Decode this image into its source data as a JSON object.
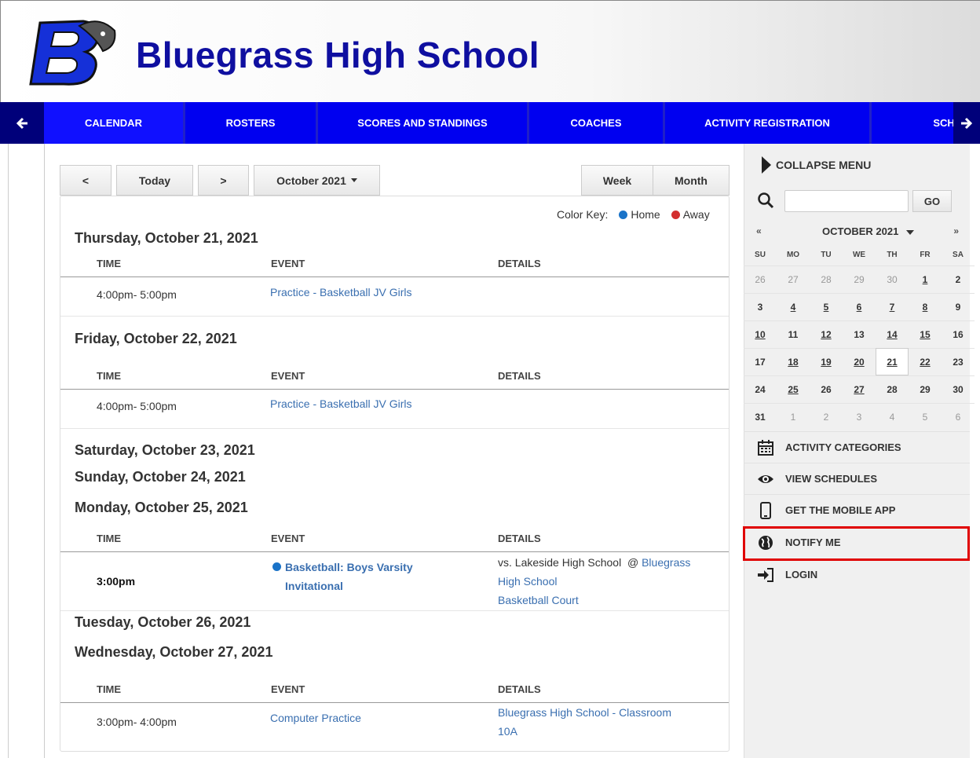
{
  "header": {
    "title": "Bluegrass High School"
  },
  "nav": {
    "items": [
      {
        "label": "CALENDAR"
      },
      {
        "label": "ROSTERS"
      },
      {
        "label": "SCORES AND STANDINGS"
      },
      {
        "label": "COACHES"
      },
      {
        "label": "ACTIVITY REGISTRATION"
      },
      {
        "label": "SCHOOL"
      }
    ]
  },
  "toolbar": {
    "prev": "<",
    "today": "Today",
    "next": ">",
    "month_select": "October 2021",
    "week": "Week",
    "month": "Month"
  },
  "color_key": {
    "label": "Color Key:",
    "home": "Home",
    "away": "Away",
    "home_color": "#1a73c8",
    "away_color": "#d32f2f"
  },
  "columns": {
    "time": "TIME",
    "event": "EVENT",
    "details": "DETAILS"
  },
  "days": [
    {
      "heading": "Thursday, October 21, 2021",
      "events": [
        {
          "time": "4:00pm- 5:00pm",
          "event": "Practice - Basketball JV Girls"
        }
      ]
    },
    {
      "heading": "Friday, October 22, 2021",
      "events": [
        {
          "time": "4:00pm- 5:00pm",
          "event": "Practice - Basketball JV Girls"
        }
      ]
    },
    {
      "heading": "Saturday, October 23, 2021"
    },
    {
      "heading": "Sunday, October 24, 2021"
    },
    {
      "heading": "Monday, October 25, 2021",
      "events": [
        {
          "time": "3:00pm",
          "event_line1": "Basketball: Boys Varsity",
          "event_line2": "Invitational",
          "details_prefix": "vs. Lakeside High School  @ ",
          "details_link1": "Bluegrass",
          "details_link2": "High School",
          "details_link3": "Basketball Court"
        }
      ]
    },
    {
      "heading": "Tuesday, October 26, 2021"
    },
    {
      "heading": "Wednesday, October 27, 2021",
      "events": [
        {
          "time": "3:00pm- 4:00pm",
          "event": "Computer Practice",
          "details_line1": "Bluegrass High School - Classroom",
          "details_line2": "10A"
        }
      ]
    }
  ],
  "sidebar": {
    "collapse": "COLLAPSE MENU",
    "go": "GO",
    "calendar": {
      "prev": "«",
      "next": "»",
      "month": "OCTOBER 2021",
      "dow": [
        "SU",
        "MO",
        "TU",
        "WE",
        "TH",
        "FR",
        "SA"
      ],
      "weeks": [
        [
          "26",
          "27",
          "28",
          "29",
          "30",
          "1",
          "2"
        ],
        [
          "3",
          "4",
          "5",
          "6",
          "7",
          "8",
          "9"
        ],
        [
          "10",
          "11",
          "12",
          "13",
          "14",
          "15",
          "16"
        ],
        [
          "17",
          "18",
          "19",
          "20",
          "21",
          "22",
          "23"
        ],
        [
          "24",
          "25",
          "26",
          "27",
          "28",
          "29",
          "30"
        ],
        [
          "31",
          "1",
          "2",
          "3",
          "4",
          "5",
          "6"
        ]
      ]
    },
    "menu": [
      {
        "label": "ACTIVITY CATEGORIES",
        "icon": "calendar-icon"
      },
      {
        "label": "VIEW SCHEDULES",
        "icon": "eye-icon"
      },
      {
        "label": "GET THE MOBILE APP",
        "icon": "mobile-icon"
      },
      {
        "label": "NOTIFY ME",
        "icon": "globe-icon"
      },
      {
        "label": "LOGIN",
        "icon": "login-icon"
      }
    ]
  }
}
